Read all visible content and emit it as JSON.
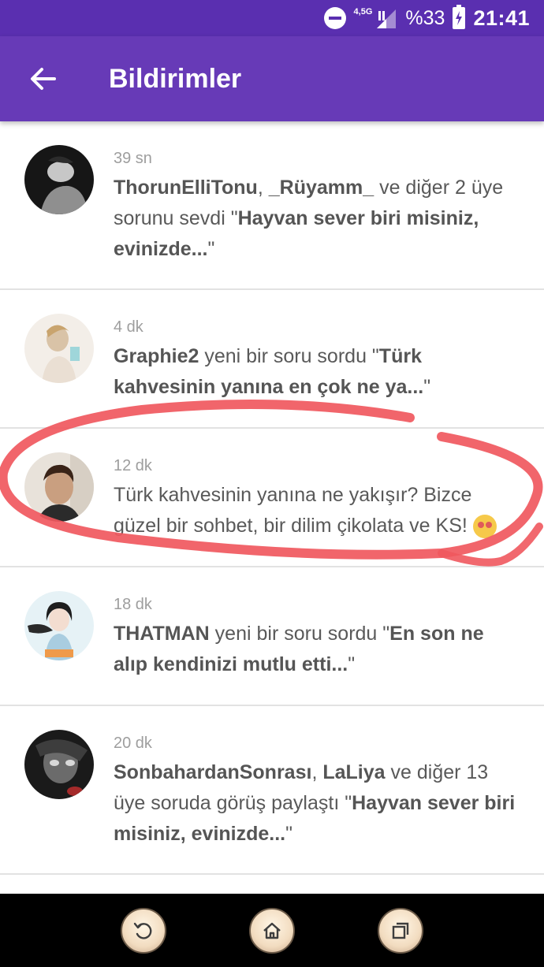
{
  "status_bar": {
    "network": "4,5G",
    "battery": "%33",
    "time": "21:41"
  },
  "app_bar": {
    "title": "Bildirimler"
  },
  "notifications": [
    {
      "time": "39 sn",
      "segments": [
        {
          "t": "ThorunElliTonu",
          "b": true
        },
        {
          "t": ", ",
          "b": false
        },
        {
          "t": "_Rüyamm_",
          "b": true
        },
        {
          "t": " ve diğer 2 üye sorunu sevdi \"",
          "b": false
        },
        {
          "t": "Hayvan sever biri misiniz, evinizde...",
          "b": true
        },
        {
          "t": "\"",
          "b": false
        }
      ]
    },
    {
      "time": "4 dk",
      "segments": [
        {
          "t": "Graphie2",
          "b": true
        },
        {
          "t": " yeni bir soru sordu \"",
          "b": false
        },
        {
          "t": "Türk kahvesinin yanına en çok ne ya...",
          "b": true
        },
        {
          "t": "\"",
          "b": false
        }
      ]
    },
    {
      "time": "12 dk",
      "segments": [
        {
          "t": "Türk kahvesinin yanına ne yakışır? Bizce güzel bir sohbet, bir dilim çikolata ve KS! ",
          "b": false
        }
      ],
      "emoji": "smiling-face-with-heart-eyes"
    },
    {
      "time": "18 dk",
      "segments": [
        {
          "t": "THATMAN",
          "b": true
        },
        {
          "t": " yeni bir soru sordu \"",
          "b": false
        },
        {
          "t": "En son ne alıp kendinizi mutlu etti...",
          "b": true
        },
        {
          "t": "\"",
          "b": false
        }
      ]
    },
    {
      "time": "20 dk",
      "segments": [
        {
          "t": "SonbahardanSonrası",
          "b": true
        },
        {
          "t": ", ",
          "b": false
        },
        {
          "t": "LaLiya",
          "b": true
        },
        {
          "t": " ve diğer 13 üye soruda görüş paylaştı \"",
          "b": false
        },
        {
          "t": "Hayvan sever biri misiniz, evinizde...",
          "b": true
        },
        {
          "t": "\"",
          "b": false
        }
      ]
    }
  ],
  "colors": {
    "status_bar": "#5a2fb0",
    "app_bar": "#673ab7",
    "highlight_stroke": "#f0585e"
  },
  "nav_bar": {
    "buttons": [
      "back-icon",
      "home-icon",
      "recent-apps-icon"
    ]
  }
}
